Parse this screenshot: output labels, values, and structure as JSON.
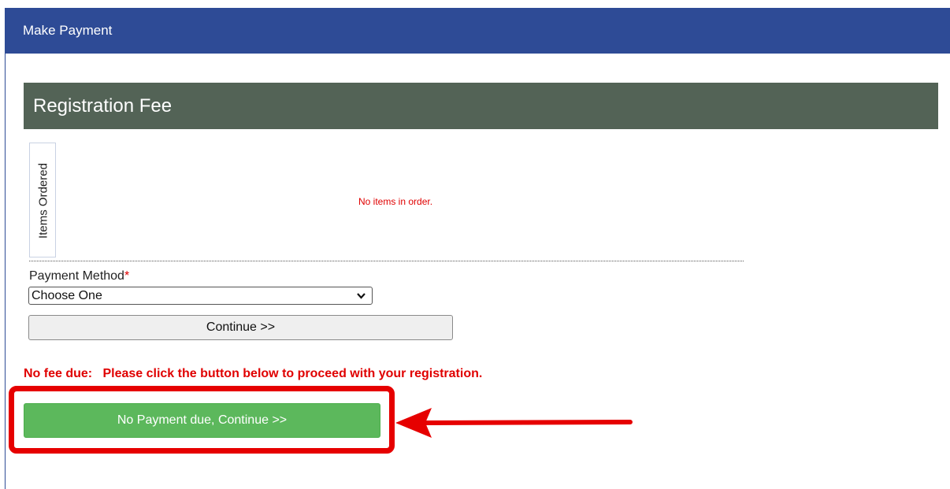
{
  "header": {
    "title": "Make Payment"
  },
  "section": {
    "title": "Registration Fee"
  },
  "order": {
    "legend": "Items Ordered",
    "empty_message": "No items in order."
  },
  "payment": {
    "label": "Payment Method",
    "required_marker": "*",
    "selected_option": "Choose One",
    "continue_label": "Continue >>"
  },
  "notice": {
    "text": "No fee due:   Please click the button below to proceed with your registration."
  },
  "no_payment_button": {
    "label": "No Payment due, Continue >>"
  },
  "colors": {
    "header_bg": "#2e4b96",
    "section_bg": "#536356",
    "alert_red": "#e00000",
    "button_green": "#5cb85c",
    "annotation_red": "#e60000"
  }
}
